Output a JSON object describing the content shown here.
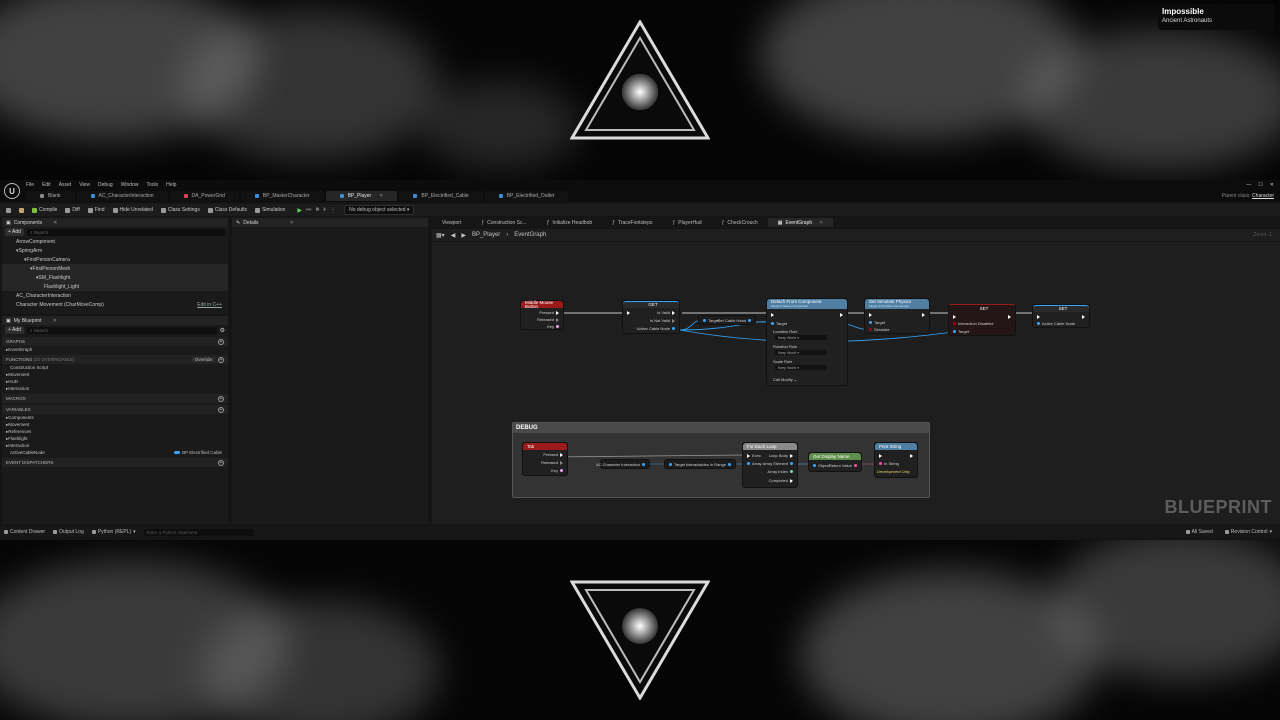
{
  "now_playing": {
    "title": "Impossible",
    "artist": "Ancient Astronauts"
  },
  "menu": [
    "File",
    "Edit",
    "Asset",
    "View",
    "Debug",
    "Window",
    "Tools",
    "Help"
  ],
  "doc_tabs": [
    {
      "label": "Blank",
      "color": "#8a8a8a"
    },
    {
      "label": "AC_CharacterInteraction",
      "color": "#3c8dd6"
    },
    {
      "label": "DA_PowerGrid",
      "color": "#d6455a"
    },
    {
      "label": "BP_MasterCharacter",
      "color": "#3c8dd6"
    },
    {
      "label": "BP_Player",
      "color": "#3c8dd6",
      "active": true
    },
    {
      "label": "BP_Electrified_Cable",
      "color": "#3c8dd6"
    },
    {
      "label": "BP_Electrified_Outlet",
      "color": "#3c8dd6"
    }
  ],
  "parent_class": {
    "label": "Parent class:",
    "value": "Character"
  },
  "toolbar": {
    "compile": "Compile",
    "diff": "Diff",
    "find": "Find",
    "hide_unrelated": "Hide Unrelated",
    "class_settings": "Class Settings",
    "class_defaults": "Class Defaults",
    "simulation": "Simulation",
    "debug_object": "No debug object selected"
  },
  "components": {
    "header": "Components",
    "add": "+ Add",
    "search_placeholder": "Search",
    "items": [
      {
        "label": "ArrowComponent",
        "indent": 1
      },
      {
        "label": "SpringArm",
        "indent": 2
      },
      {
        "label": "FirstPersonCamera",
        "indent": 3
      },
      {
        "label": "FirstPersonMesh",
        "indent": 4
      },
      {
        "label": "SM_Flashlight",
        "indent": 5
      },
      {
        "label": "Flashlight_Light",
        "indent": 6
      },
      {
        "label": "AC_CharacterInteraction",
        "indent": 1
      },
      {
        "label": "Character Movement (CharMoveComp)",
        "indent": 1
      }
    ],
    "edit_cpp": "Edit in C++"
  },
  "my_blueprint": {
    "header": "My Blueprint",
    "add": "+ Add",
    "search_placeholder": "Search",
    "graphs_hdr": "GRAPHS",
    "graphs": [
      "EventGraph"
    ],
    "functions_hdr": "FUNCTIONS",
    "functions_count": "(23 OVERRIDABLE)",
    "override": "Override",
    "functions": [
      "Construction Script",
      "Movement",
      "HUD",
      "Interaction"
    ],
    "macros_hdr": "MACROS",
    "variables_hdr": "VARIABLES",
    "variables": [
      "Components",
      "Movement",
      "References",
      "Flashlight",
      "Interaction"
    ],
    "active_var": {
      "name": "ActiveCableNode",
      "type": "BP Electrified Cable"
    },
    "dispatchers_hdr": "EVENT DISPATCHERS"
  },
  "details": {
    "header": "Details"
  },
  "graph_tabs": [
    {
      "label": "Viewport"
    },
    {
      "label": "Construction Sc..."
    },
    {
      "label": "Initialize Headbob"
    },
    {
      "label": "TraceFootsteps"
    },
    {
      "label": "PlayerHud"
    },
    {
      "label": "CheckCrouch"
    },
    {
      "label": "EventGraph",
      "active": true
    }
  ],
  "breadcrumb": {
    "root": "BP_Player",
    "graph": "EventGraph",
    "zoom": "Zoom -1"
  },
  "watermark": "BLUEPRINT",
  "nodes": {
    "mouse": {
      "title": "Middle Mouse Button",
      "pressed": "Pressed",
      "released": "Released",
      "key": "Key"
    },
    "get": {
      "title": "GET",
      "is_valid": "Is Valid",
      "is_not_valid": "Is Not Valid",
      "var": "Active Cable Node"
    },
    "get_cable_head": "Get Cable Head",
    "target": "Target",
    "detach": {
      "title": "Detach From Component",
      "subtitle": "Target is Scene Component",
      "target": "Target",
      "location_rule": "Location Rule",
      "rotation_rule": "Rotation Rule",
      "scale_rule": "Scale Rule",
      "keep_world": "Keep World",
      "call_modify": "Call Modify"
    },
    "simulate": {
      "title": "Set Simulate Physics",
      "subtitle": "Target is Primitive Component",
      "target": "Target",
      "simulate": "Simulate"
    },
    "set_interaction": {
      "title": "SET",
      "label": "Interaction Disabled",
      "target": "Target"
    },
    "set_cable": {
      "title": "SET",
      "label": "Active Cable Node"
    }
  },
  "debug": {
    "title": "DEBUG",
    "tab": {
      "title": "Tab",
      "pressed": "Pressed",
      "released": "Released",
      "key": "Key"
    },
    "char_interaction": "AC Character Interaction",
    "target": "Target",
    "interactables": "Interactables in Range",
    "foreach": {
      "title": "For Each Loop",
      "exec": "Exec",
      "loop_body": "Loop Body",
      "array": "Array",
      "array_element": "Array Element",
      "array_index": "Array Index",
      "completed": "Completed"
    },
    "display_name": {
      "title": "Get Display Name",
      "object": "Object",
      "return_value": "Return Value"
    },
    "print": {
      "title": "Print String",
      "in_string": "In String",
      "dev": "Development Only"
    }
  },
  "statusbar": {
    "content_drawer": "Content Drawer",
    "output_log": "Output Log",
    "python": "Python (REPL)",
    "cmd_placeholder": "Enter a Python statement",
    "all_saved": "All Saved",
    "revision": "Revision Control"
  }
}
